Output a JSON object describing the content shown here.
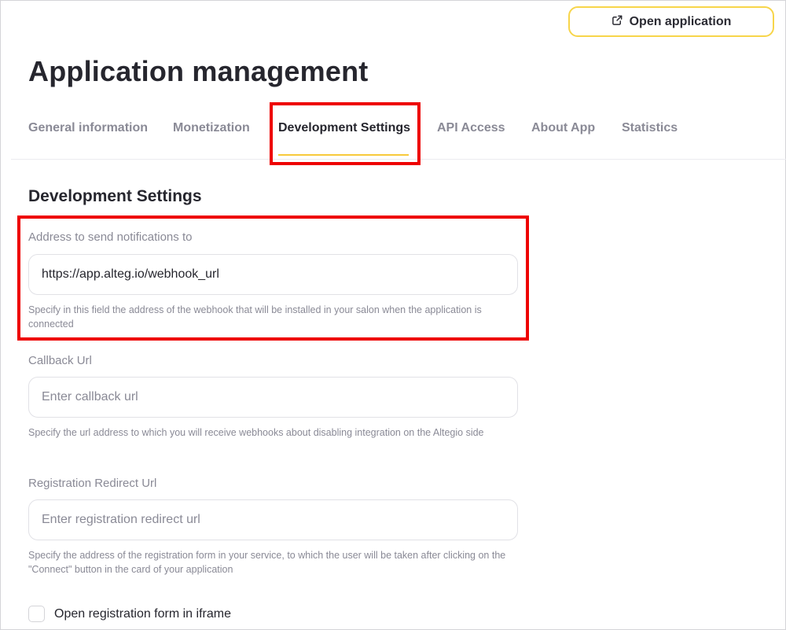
{
  "header": {
    "open_app_label": "Open application"
  },
  "page": {
    "title": "Application management"
  },
  "tabs": [
    {
      "label": "General information"
    },
    {
      "label": "Monetization"
    },
    {
      "label": "Development Settings"
    },
    {
      "label": "API Access"
    },
    {
      "label": "About App"
    },
    {
      "label": "Statistics"
    }
  ],
  "active_tab": "Development Settings",
  "section": {
    "title": "Development Settings"
  },
  "fields": {
    "notifications": {
      "label": "Address to send notifications to",
      "value": "https://app.alteg.io/webhook_url",
      "hint": "Specify in this field the address of the webhook that will be installed in your salon when the application is connected"
    },
    "callback": {
      "label": "Callback Url",
      "placeholder": "Enter callback url",
      "hint": "Specify the url address to which you will receive webhooks about disabling integration on the Altegio side"
    },
    "redirect": {
      "label": "Registration Redirect Url",
      "placeholder": "Enter registration redirect url",
      "hint": "Specify the address of the registration form in your service, to which the user will be taken after clicking on the \"Connect\" button in the card of your application"
    }
  },
  "checkbox": {
    "label": "Open registration form in iframe",
    "checked": false
  },
  "colors": {
    "accent_yellow": "#f7d54a",
    "highlight_red": "#ee0000",
    "text_primary": "#26262e",
    "text_muted": "#8a8a96"
  },
  "icons": {
    "open_app": "external-link-icon"
  }
}
